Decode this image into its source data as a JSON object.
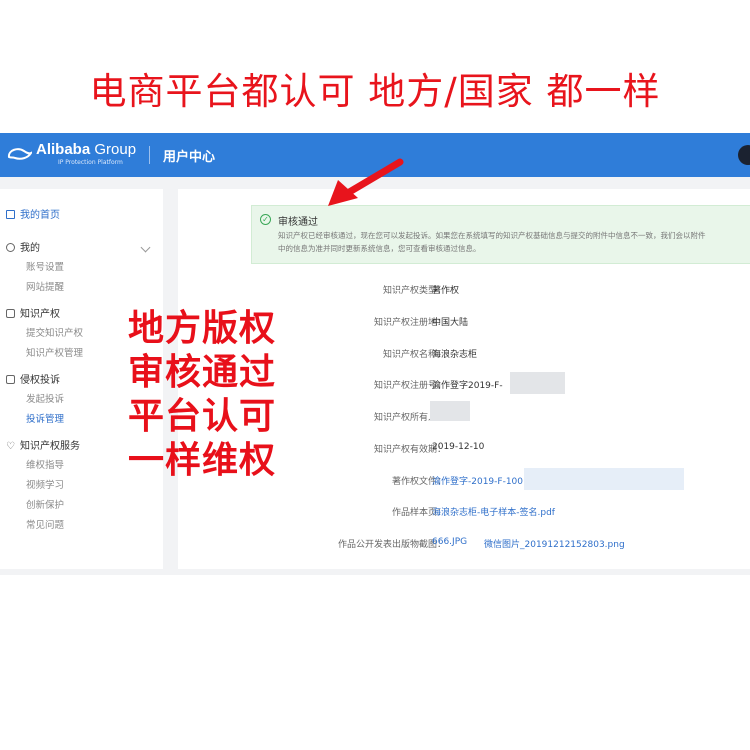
{
  "banner": {
    "text": "电商平台都认可  地方/国家  都一样"
  },
  "header": {
    "logo_brand": "Alibaba",
    "logo_group": " Group",
    "logo_subtitle": "IP Protection Platform",
    "title": "用户中心"
  },
  "sidebar": {
    "home": "我的首页",
    "groups": [
      {
        "label": "我的",
        "icon": "user-icon",
        "items": [
          "账号设置",
          "网站提醒"
        ]
      },
      {
        "label": "知识产权",
        "icon": "book-icon",
        "items": [
          "提交知识产权",
          "知识产权管理"
        ]
      },
      {
        "label": "侵权投诉",
        "icon": "document-icon",
        "items": [
          "发起投诉",
          "投诉管理"
        ]
      },
      {
        "label": "知识产权服务",
        "icon": "heart-icon",
        "items": [
          "维权指导",
          "视频学习",
          "创新保护",
          "常见问题"
        ]
      }
    ],
    "active_item": "投诉管理"
  },
  "overlay_text": [
    "地方版权",
    "审核通过",
    "平台认可",
    "一样维权"
  ],
  "notice": {
    "title": "审核通过",
    "line1": "知识产权已经审核通过，现在您可以发起投诉。如果您在系统填写的知识产权基础信息与提交的附件中信息不一致，我们会以附件",
    "line2": "中的信息为准并同时更新系统信息，您可查看审核通过信息。"
  },
  "fields": [
    {
      "label": "知识产权类型：",
      "value": "著作权"
    },
    {
      "label": "知识产权注册地：",
      "value": "中国大陆"
    },
    {
      "label": "知识产权名称：",
      "value": "海浪杂志柜"
    },
    {
      "label": "知识产权注册号：",
      "value": "渝作登字2019-F-"
    },
    {
      "label": "知识产权所有人：",
      "value": ""
    },
    {
      "label": "知识产权有效期：",
      "value": "2019-12-10"
    },
    {
      "label": "著作权文件：",
      "value": "渝作登字-2019-F-100"
    },
    {
      "label": "作品样本页：",
      "value": "海浪杂志柜-电子样本-签名.pdf"
    },
    {
      "label": "作品公开发表出版物截图：",
      "value": "666.JPG",
      "value2": "微信图片_20191212152803.png"
    }
  ],
  "colors": {
    "banner_red": "#e8141c",
    "header_blue": "#2f7dd9",
    "link_blue": "#2f6fca",
    "notice_green": "#e9f6ea"
  }
}
